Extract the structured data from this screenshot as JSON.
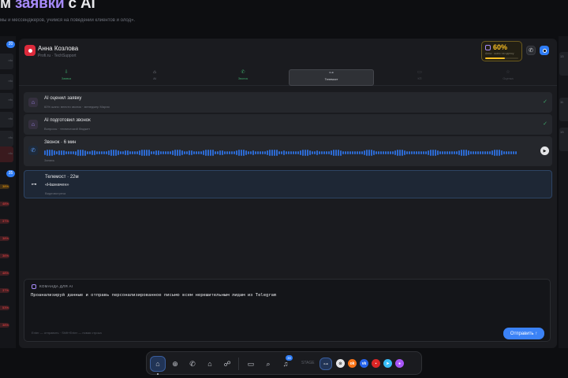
{
  "header": {
    "title_prefix": "м ",
    "title_accent": "заявки",
    "title_suffix": " с AI",
    "subtitle": "мы и мессенджеров, учимся на поведении клиентов и олод»."
  },
  "left_strip": {
    "badge_top": "20",
    "badge_mid": "35",
    "percents": [
      "38%",
      "48%",
      "37%",
      "38%",
      "36%",
      "48%",
      "37%",
      "53%",
      "38%"
    ],
    "percent_colors": [
      "#f59e0b",
      "#ef4444",
      "#ef4444",
      "#ef4444",
      "#ef4444",
      "#ef4444",
      "#ef4444",
      "#ef4444",
      "#ef4444"
    ]
  },
  "contact": {
    "name": "Анна Козлова",
    "sub": "Profi.ru · TechSupport",
    "score_pct": "60%",
    "score_label": "Анна · шанс на сделку",
    "score_value": 0.6
  },
  "tabs": [
    {
      "icon": "⇩",
      "label": "Заявка"
    },
    {
      "icon": "⌂",
      "label": "AI"
    },
    {
      "icon": "✆",
      "label": "Звонок"
    },
    {
      "icon": "⊶",
      "label": "Телемост"
    },
    {
      "icon": "▭",
      "label": "КП"
    },
    {
      "icon": "☆",
      "label": "Оценка"
    }
  ],
  "timeline": {
    "row1_title": "AI оценил заявку",
    "row1_sub": "60% шанс: внести звонок · менеджер Мария",
    "row2_title": "AI подготовил звонок",
    "row2_sub": "Вопросы · технический бюджет",
    "call_title": "Звонок · 6 мин",
    "call_sub": "Запись",
    "tele_title": "Телемост · 22м",
    "tele_main": "«Назначен»",
    "tele_sub": "Видеовстреча"
  },
  "command": {
    "header": "КОМАНДА ДЛЯ AI",
    "text": "Проанализируй данные и отправь персонализированное письмо всем нерешительным лидам из Telegram",
    "hint": "Enter — отправить · Shift+Enter — новая строка",
    "send_label": "Отправить ↑"
  },
  "right_strip": {
    "card1": "13",
    "card2": "11",
    "card3": "13"
  },
  "dock": {
    "badge": "39",
    "label": "STAGE",
    "apps": [
      {
        "name": "яндекс",
        "glyph": "⊙",
        "color": "#e4e5e8"
      },
      {
        "name": "ok",
        "glyph": "ok",
        "color": "#f97316"
      },
      {
        "name": "vk",
        "glyph": "vk",
        "color": "#2563eb"
      },
      {
        "name": "avito",
        "glyph": "▪",
        "color": "#dc2626"
      },
      {
        "name": "telegram",
        "glyph": "➤",
        "color": "#38bdf8"
      },
      {
        "name": "max",
        "glyph": "●",
        "color": "#a855f7"
      }
    ]
  }
}
